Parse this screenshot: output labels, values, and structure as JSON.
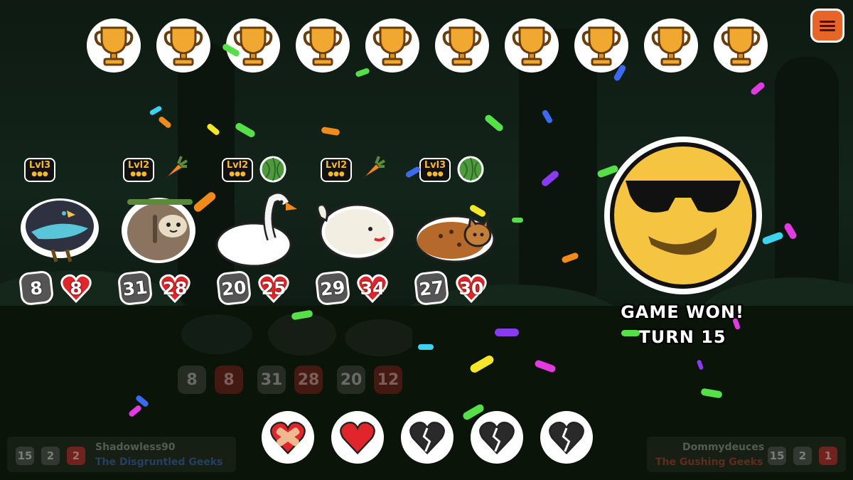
{
  "trophies": {
    "count": 10,
    "icon": "trophy-icon",
    "color": "#f0a830"
  },
  "menu": {
    "icon": "hamburger-menu-icon",
    "color": "#e8652a"
  },
  "team": [
    {
      "animal": "bird",
      "level": "3",
      "food": "",
      "attack": "8",
      "health": "8"
    },
    {
      "animal": "sloth",
      "level": "2",
      "food": "carrot",
      "attack": "31",
      "health": "28"
    },
    {
      "animal": "swan",
      "level": "2",
      "food": "melon",
      "attack": "20",
      "health": "25"
    },
    {
      "animal": "whale",
      "level": "2",
      "food": "carrot",
      "attack": "29",
      "health": "34"
    },
    {
      "animal": "cat",
      "level": "3",
      "food": "melon",
      "attack": "27",
      "health": "30"
    }
  ],
  "level_prefix": "Lvl",
  "opponent_team": [
    {
      "attack": "8",
      "health": "8"
    },
    {
      "attack": "31",
      "health": "28"
    },
    {
      "attack": "20",
      "health": "12"
    }
  ],
  "result": {
    "title": "GAME WON!",
    "turn": "TURN 15",
    "emoji": "sunglasses-face-icon"
  },
  "lives": [
    {
      "state": "bandaged",
      "icon": "bandaged-heart-icon"
    },
    {
      "state": "full",
      "icon": "heart-icon"
    },
    {
      "state": "broken",
      "icon": "broken-heart-icon"
    },
    {
      "state": "broken",
      "icon": "broken-heart-icon"
    },
    {
      "state": "broken",
      "icon": "broken-heart-icon"
    }
  ],
  "player_left": {
    "name": "Shadowless90",
    "team": "The Disgruntled Geeks",
    "turn": "15",
    "wins": "2",
    "lives": "2",
    "team_color": "#3b6fd6"
  },
  "player_right": {
    "name": "Dommydeuces",
    "team": "The Gushing Geeks",
    "turn": "15",
    "wins": "2",
    "lives": "1",
    "team_color": "#c8402a"
  },
  "colors": {
    "attack_bg": "#555555",
    "health_red": "#e0262a",
    "face_yellow": "#f5c542",
    "gold": "#f5b82e"
  }
}
